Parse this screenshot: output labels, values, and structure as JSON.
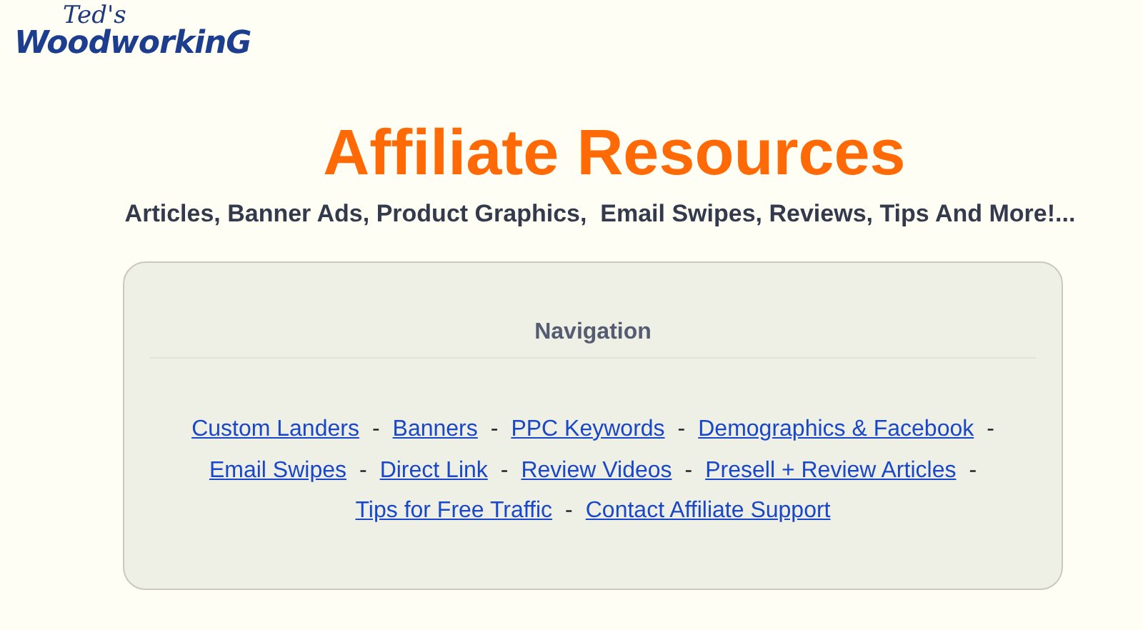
{
  "logo": {
    "script": "Ted's",
    "wordmark": "WoodworkinG"
  },
  "title": "Affiliate Resources",
  "subtitle": "Articles, Banner Ads, Product Graphics,  Email Swipes, Reviews, Tips And More!...",
  "navigation": {
    "heading": "Navigation",
    "lines": [
      [
        {
          "label": "Custom Landers",
          "after": "-"
        },
        {
          "label": "Banners",
          "after": "-"
        },
        {
          "label": "PPC Keywords",
          "after": "-"
        },
        {
          "label": "Demographics & Facebook",
          "after": "-"
        }
      ],
      [
        {
          "label": "Email Swipes",
          "after": "-"
        },
        {
          "label": "Direct Link",
          "after": "-"
        },
        {
          "label": "Review Videos",
          "after": "-"
        },
        {
          "label": "Presell + Review Articles",
          "after": "-"
        }
      ],
      [
        {
          "label": "Tips for Free Traffic",
          "after": "-"
        },
        {
          "label": "Contact Affiliate Support"
        }
      ]
    ]
  }
}
